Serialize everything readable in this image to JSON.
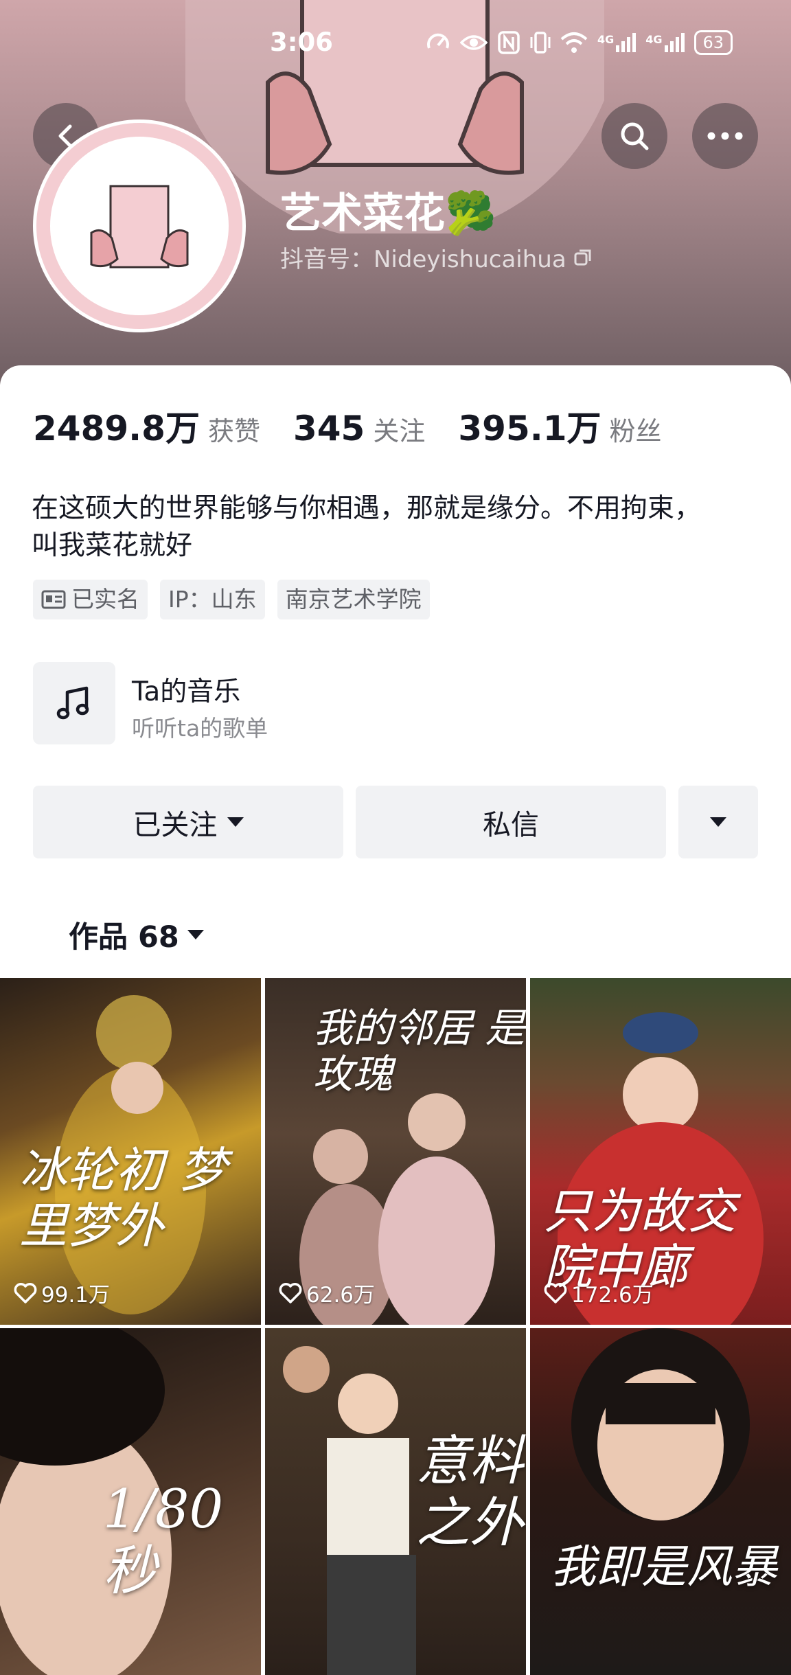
{
  "status_bar": {
    "time": "3:06",
    "battery": "63",
    "network_1": "4G",
    "network_2": "4G"
  },
  "profile": {
    "name": "艺术菜花🥦",
    "douyin_id": "抖音号：Nideyishucaihua",
    "stats": [
      {
        "value": "2489.8万",
        "label": "获赞"
      },
      {
        "value": "345",
        "label": "关注"
      },
      {
        "value": "395.1万",
        "label": "粉丝"
      }
    ],
    "bio_line1": "在这硕大的世界能够与你相遇，那就是缘分。不用拘束，",
    "bio_line2": "叫我菜花就好",
    "tags": [
      "已实名",
      "IP：山东",
      "南京艺术学院"
    ],
    "music": {
      "title": "Ta的音乐",
      "subtitle": "听听ta的歌单"
    }
  },
  "actions": {
    "follow": "已关注",
    "message": "私信"
  },
  "works": {
    "tab_label": "作品 68",
    "items": [
      {
        "caption": "冰轮初 梦里梦外",
        "likes": "99.1万"
      },
      {
        "caption": "我的邻居 是玫瑰",
        "likes": "62.6万"
      },
      {
        "caption": "只为故交 院中廊",
        "likes": "172.6万"
      },
      {
        "caption": "1/80 秒",
        "likes": ""
      },
      {
        "caption": "意料 之外",
        "likes": ""
      },
      {
        "caption": "我即是风暴",
        "likes": ""
      }
    ]
  },
  "colors": {
    "header_top": "#cfa6aa",
    "header_bottom": "#6f5f63",
    "text_primary": "#161823",
    "text_secondary": "#7a7b80",
    "chip_bg": "#f1f2f4"
  }
}
